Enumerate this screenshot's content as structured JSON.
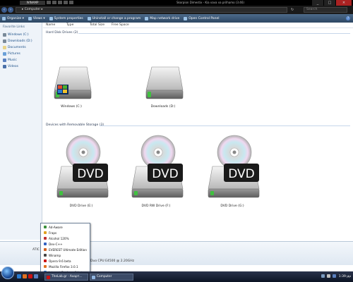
{
  "winamp": {
    "logo": "WINAMP",
    "title": "Skorpion Dimestix - Kia vava va prilhamo (3:46)"
  },
  "window": {
    "controls": [
      "_",
      "□",
      "×"
    ]
  },
  "address": {
    "path": "▸ Computer ▸",
    "search_placeholder": "Search"
  },
  "toolbar": {
    "items": [
      "Organize ▾",
      "Views ▾",
      "System properties",
      "Uninstall or change a program",
      "Map network drive",
      "Open Control Panel"
    ],
    "help": "?"
  },
  "sidebar": {
    "title": "Favorite Links",
    "items": [
      {
        "label": "Windows (C:)",
        "icon": "drive-icon"
      },
      {
        "label": "Downloads (D:)",
        "icon": "drive-icon"
      },
      {
        "label": "Documents",
        "icon": "documents-icon"
      },
      {
        "label": "Pictures",
        "icon": "pictures-icon"
      },
      {
        "label": "Music",
        "icon": "music-icon"
      },
      {
        "label": "Videos",
        "icon": "videos-icon"
      }
    ],
    "folders": "Folders"
  },
  "columns": [
    "Name",
    "Type",
    "Total Size",
    "Free Space"
  ],
  "groups": {
    "hdd": "Hard Disk Drives (2)",
    "removable": "Devices with Removable Storage (3)"
  },
  "hard_drives": [
    {
      "label": "Windows (C:)",
      "has_logo": true
    },
    {
      "label": "Downloads (D:)",
      "has_logo": false
    }
  ],
  "dvd_drives": [
    {
      "label": "DVD Drive (E:)",
      "text": "DVD"
    },
    {
      "label": "DVD RW Drive (F:)",
      "text": "DVD"
    },
    {
      "label": "DVD Drive (G:)",
      "text": "DVD"
    }
  ],
  "details": {
    "name": "ATIC",
    "cpu_text": "Duo CPU     E4500  @ 2.20GHz"
  },
  "start_menu": {
    "items": [
      {
        "label": "Ad-Aware",
        "color": "#3a8f3a"
      },
      {
        "label": "Fraps",
        "color": "#e0a020"
      },
      {
        "label": "Alcohol 120%",
        "color": "#c03030"
      },
      {
        "label": "Dev-C++",
        "color": "#3060c0"
      },
      {
        "label": "EVEREST Ultimate Edition",
        "color": "#d06020"
      },
      {
        "label": "Winamp",
        "color": "#444444"
      },
      {
        "label": "Opera 9.6 beta",
        "color": "#cc1111"
      },
      {
        "label": "Mozilla Firefox 3.0.1",
        "color": "#e07020"
      },
      {
        "label": "Internet Explorer 8 beta",
        "color": "#2a7ad0"
      }
    ]
  },
  "taskbar": {
    "buttons": [
      {
        "label": "TheLab.gr - Αναρτ...",
        "color": "#cc1111"
      },
      {
        "label": "Computer",
        "color": "#8fb4e0"
      }
    ],
    "clock": "1:39 μμ"
  },
  "colors": {
    "toolbar": "#3b5878",
    "sidebar_bg": "#eef3f9",
    "link": "#1b4f87"
  }
}
